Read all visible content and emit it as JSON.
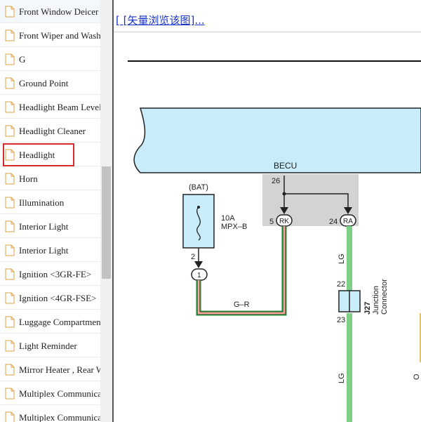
{
  "sidebar": {
    "items": [
      {
        "label": "Front Window Deicer"
      },
      {
        "label": "Front Wiper and Washer"
      },
      {
        "label": "G"
      },
      {
        "label": "Ground Point"
      },
      {
        "label": "Headlight Beam Level"
      },
      {
        "label": "Headlight Cleaner"
      },
      {
        "label": "Headlight",
        "selected": true
      },
      {
        "label": "Horn"
      },
      {
        "label": "Illumination"
      },
      {
        "label": "Interior Light"
      },
      {
        "label": "Interior Light"
      },
      {
        "label": "Ignition <3GR-FE>"
      },
      {
        "label": "Ignition <4GR-FSE>"
      },
      {
        "label": "Luggage Compartment"
      },
      {
        "label": "Light Reminder"
      },
      {
        "label": "Mirror Heater , Rear Window"
      },
      {
        "label": "Multiplex Communication"
      },
      {
        "label": "Multiplex Communication"
      }
    ],
    "icon": "document-icon"
  },
  "content": {
    "vector_link": "[ [矢量浏览该图]..."
  },
  "diagram": {
    "becu_label": "BECU",
    "becu_pin_top": "26",
    "pin_rk_number": "5",
    "pin_rk": "RK",
    "pin_ra_number": "24",
    "pin_ra": "RA",
    "bat_label": "(BAT)",
    "fuse_rating": "10A",
    "fuse_name": "MPX–B",
    "fuse_pin": "2",
    "connector_pin": "1",
    "wire_gr": "G–R",
    "wire_lg_upper": "LG",
    "wire_lg_lower": "LG",
    "junction_pin_top": "22",
    "junction_pin_bottom": "23",
    "junction_id": "J27",
    "junction_label_1": "Junction",
    "junction_label_2": "Connector",
    "edge_label": "O",
    "colors": {
      "ecu_fill": "#c8ecfa",
      "shade": "#d3d3d3",
      "wire_green": "#7dcf86",
      "wire_red": "#e05050",
      "wire_dark_green": "#1f8a35"
    }
  }
}
